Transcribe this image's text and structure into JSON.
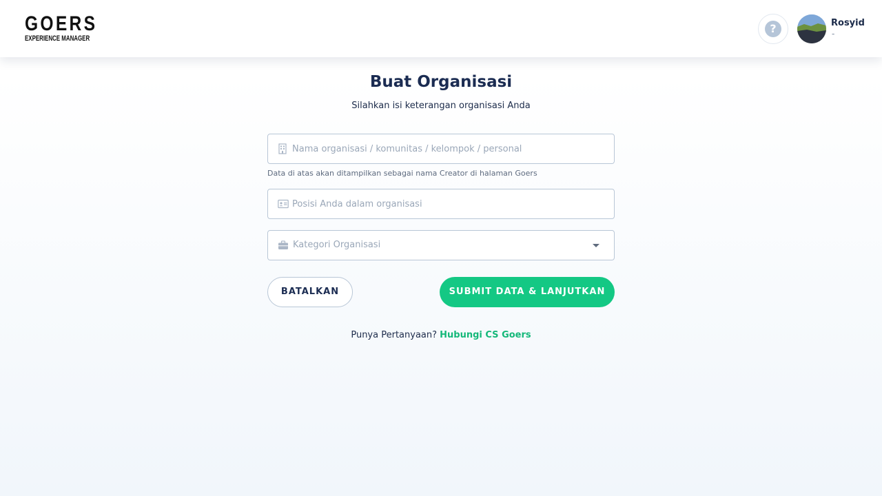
{
  "header": {
    "logo_main": "GOERS",
    "logo_sub": "EXPERIENCE MANAGER",
    "help_glyph": "?",
    "help_icon": "question-circle-icon",
    "user_name": "Rosyid",
    "user_sub": "-"
  },
  "page": {
    "title": "Buat Organisasi",
    "subtitle": "Silahkan isi keterangan organisasi Anda"
  },
  "form": {
    "org_name": {
      "placeholder": "Nama organisasi / komunitas / kelompok / personal",
      "value": "",
      "icon": "building-icon",
      "helper": "Data di atas akan ditampilkan sebagai nama Creator di halaman Goers"
    },
    "position": {
      "placeholder": "Posisi Anda dalam organisasi",
      "value": "",
      "icon": "id-card-icon"
    },
    "category": {
      "label": "Kategori Organisasi",
      "icon": "briefcase-icon"
    }
  },
  "actions": {
    "cancel": "BATALKAN",
    "submit": "SUBMIT DATA & LANJUTKAN"
  },
  "footer": {
    "question": "Punya Pertanyaan?",
    "link": "Hubungi CS Goers"
  },
  "colors": {
    "accent": "#14c884",
    "title": "#1b2c52",
    "border": "#b8c6d6"
  }
}
